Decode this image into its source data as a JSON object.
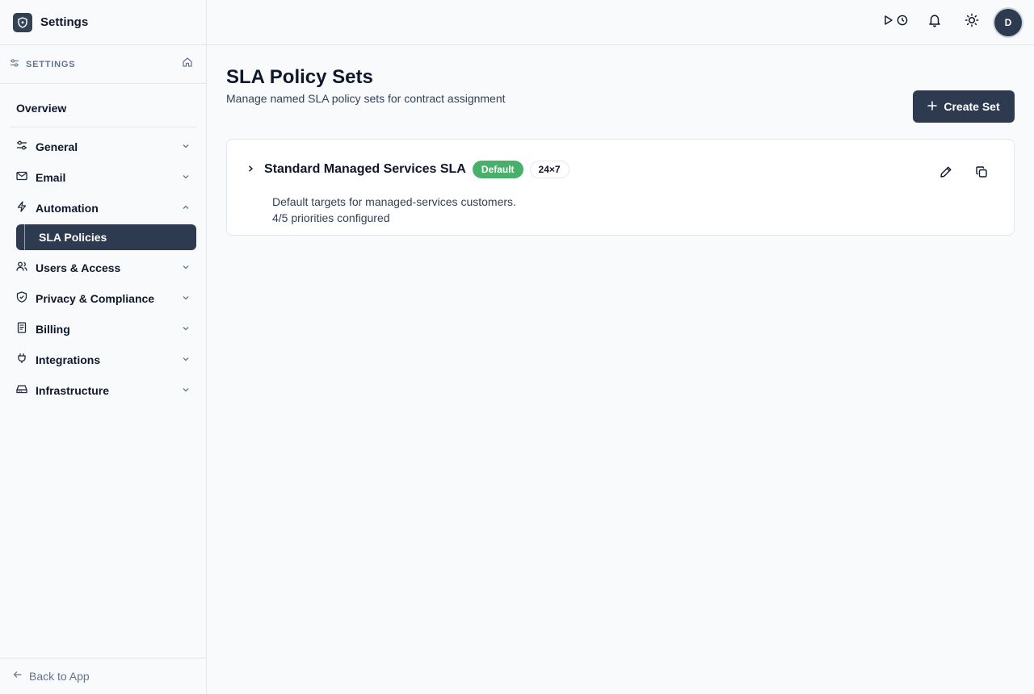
{
  "app": {
    "title": "Settings"
  },
  "sidebar": {
    "section_label": "SETTINGS",
    "overview_label": "Overview",
    "items": [
      {
        "label": "General",
        "icon": "sliders-icon",
        "expanded": false
      },
      {
        "label": "Email",
        "icon": "mail-icon",
        "expanded": false
      },
      {
        "label": "Automation",
        "icon": "zap-icon",
        "expanded": true,
        "children": [
          {
            "label": "SLA Policies",
            "active": true
          }
        ]
      },
      {
        "label": "Users & Access",
        "icon": "users-icon",
        "expanded": false
      },
      {
        "label": "Privacy & Compliance",
        "icon": "shield-icon",
        "expanded": false
      },
      {
        "label": "Billing",
        "icon": "receipt-icon",
        "expanded": false
      },
      {
        "label": "Integrations",
        "icon": "plug-icon",
        "expanded": false
      },
      {
        "label": "Infrastructure",
        "icon": "hard-drive-icon",
        "expanded": false
      }
    ],
    "back_label": "Back to App"
  },
  "topbar": {
    "avatar_initial": "D"
  },
  "page": {
    "title": "SLA Policy Sets",
    "subtitle": "Manage named SLA policy sets for contract assignment",
    "create_label": "Create Set"
  },
  "policy_sets": [
    {
      "name": "Standard Managed Services SLA",
      "badge_default": "Default",
      "badge_hours": "24×7",
      "description": "Default targets for managed-services customers.",
      "priorities": "4/5 priorities configured"
    }
  ],
  "colors": {
    "primary": "#2d3a4f",
    "success": "#48b06a",
    "border": "#e2e8f0",
    "background": "#f8fafc"
  }
}
